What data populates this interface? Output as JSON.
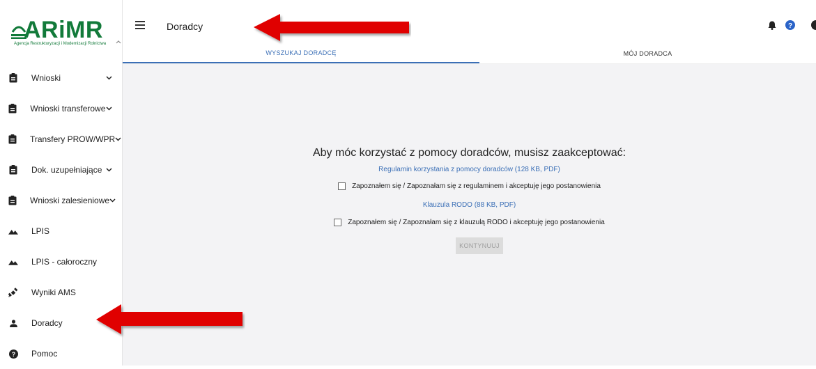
{
  "logo": {
    "name": "ARiMR",
    "subtitle": "Agencja Restrukturyzacji i Modernizacji Rolnictwa"
  },
  "sidebar": {
    "items": [
      {
        "label": "Wnioski",
        "icon": "clipboard-icon",
        "chevron": true
      },
      {
        "label": "Wnioski transferowe",
        "icon": "clipboard-icon",
        "chevron": true
      },
      {
        "label": "Transfery PROW/WPR",
        "icon": "clipboard-icon",
        "chevron": true
      },
      {
        "label": "Dok. uzupełniające",
        "icon": "clipboard-icon",
        "chevron": true
      },
      {
        "label": "Wnioski zalesieniowe",
        "icon": "clipboard-icon",
        "chevron": true
      },
      {
        "label": "LPIS",
        "icon": "terrain-icon",
        "chevron": false
      },
      {
        "label": "LPIS - całoroczny",
        "icon": "terrain-icon",
        "chevron": false
      },
      {
        "label": "Wyniki AMS",
        "icon": "satellite-icon",
        "chevron": false
      },
      {
        "label": "Doradcy",
        "icon": "person-icon",
        "chevron": false
      },
      {
        "label": "Pomoc",
        "icon": "help-icon",
        "chevron": false
      }
    ]
  },
  "header": {
    "title": "Doradcy"
  },
  "tabs": [
    {
      "label": "WYSZUKAJ DORADCĘ",
      "active": true
    },
    {
      "label": "MÓJ DORADCA",
      "active": false
    }
  ],
  "main": {
    "heading": "Aby móc korzystać z pomocy doradców, musisz zaakceptować:",
    "regulamin_link": "Regulamin korzystania z pomocy doradców (128 KB, PDF)",
    "regulamin_check": "Zapoznałem się / Zapoznałam się z regulaminem i akceptuję jego postanowienia",
    "rodo_link": "Klauzula RODO (88 KB, PDF)",
    "rodo_check": "Zapoznałem się / Zapoznałam się z klauzulą RODO i akceptuję jego postanowienia",
    "continue_label": "KONTYNUUJ"
  },
  "colors": {
    "brand_green": "#127a3a",
    "accent_blue": "#3b6fb6",
    "arrow_red": "#e00000"
  }
}
